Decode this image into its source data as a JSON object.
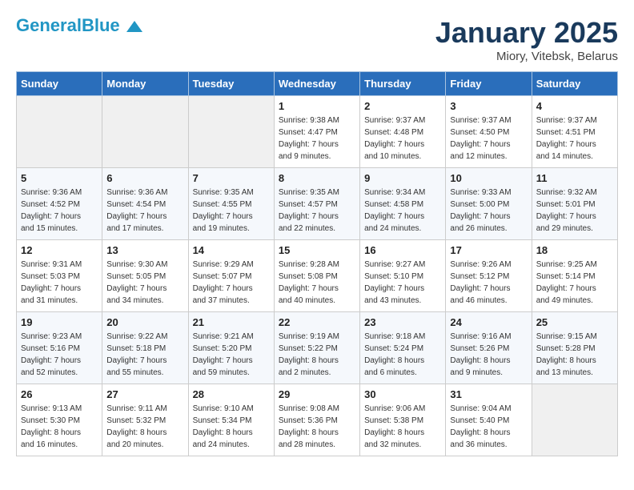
{
  "header": {
    "logo_line1": "General",
    "logo_line2": "Blue",
    "month": "January 2025",
    "location": "Miory, Vitebsk, Belarus"
  },
  "days_of_week": [
    "Sunday",
    "Monday",
    "Tuesday",
    "Wednesday",
    "Thursday",
    "Friday",
    "Saturday"
  ],
  "weeks": [
    [
      {
        "day": "",
        "info": ""
      },
      {
        "day": "",
        "info": ""
      },
      {
        "day": "",
        "info": ""
      },
      {
        "day": "1",
        "info": "Sunrise: 9:38 AM\nSunset: 4:47 PM\nDaylight: 7 hours\nand 9 minutes."
      },
      {
        "day": "2",
        "info": "Sunrise: 9:37 AM\nSunset: 4:48 PM\nDaylight: 7 hours\nand 10 minutes."
      },
      {
        "day": "3",
        "info": "Sunrise: 9:37 AM\nSunset: 4:50 PM\nDaylight: 7 hours\nand 12 minutes."
      },
      {
        "day": "4",
        "info": "Sunrise: 9:37 AM\nSunset: 4:51 PM\nDaylight: 7 hours\nand 14 minutes."
      }
    ],
    [
      {
        "day": "5",
        "info": "Sunrise: 9:36 AM\nSunset: 4:52 PM\nDaylight: 7 hours\nand 15 minutes."
      },
      {
        "day": "6",
        "info": "Sunrise: 9:36 AM\nSunset: 4:54 PM\nDaylight: 7 hours\nand 17 minutes."
      },
      {
        "day": "7",
        "info": "Sunrise: 9:35 AM\nSunset: 4:55 PM\nDaylight: 7 hours\nand 19 minutes."
      },
      {
        "day": "8",
        "info": "Sunrise: 9:35 AM\nSunset: 4:57 PM\nDaylight: 7 hours\nand 22 minutes."
      },
      {
        "day": "9",
        "info": "Sunrise: 9:34 AM\nSunset: 4:58 PM\nDaylight: 7 hours\nand 24 minutes."
      },
      {
        "day": "10",
        "info": "Sunrise: 9:33 AM\nSunset: 5:00 PM\nDaylight: 7 hours\nand 26 minutes."
      },
      {
        "day": "11",
        "info": "Sunrise: 9:32 AM\nSunset: 5:01 PM\nDaylight: 7 hours\nand 29 minutes."
      }
    ],
    [
      {
        "day": "12",
        "info": "Sunrise: 9:31 AM\nSunset: 5:03 PM\nDaylight: 7 hours\nand 31 minutes."
      },
      {
        "day": "13",
        "info": "Sunrise: 9:30 AM\nSunset: 5:05 PM\nDaylight: 7 hours\nand 34 minutes."
      },
      {
        "day": "14",
        "info": "Sunrise: 9:29 AM\nSunset: 5:07 PM\nDaylight: 7 hours\nand 37 minutes."
      },
      {
        "day": "15",
        "info": "Sunrise: 9:28 AM\nSunset: 5:08 PM\nDaylight: 7 hours\nand 40 minutes."
      },
      {
        "day": "16",
        "info": "Sunrise: 9:27 AM\nSunset: 5:10 PM\nDaylight: 7 hours\nand 43 minutes."
      },
      {
        "day": "17",
        "info": "Sunrise: 9:26 AM\nSunset: 5:12 PM\nDaylight: 7 hours\nand 46 minutes."
      },
      {
        "day": "18",
        "info": "Sunrise: 9:25 AM\nSunset: 5:14 PM\nDaylight: 7 hours\nand 49 minutes."
      }
    ],
    [
      {
        "day": "19",
        "info": "Sunrise: 9:23 AM\nSunset: 5:16 PM\nDaylight: 7 hours\nand 52 minutes."
      },
      {
        "day": "20",
        "info": "Sunrise: 9:22 AM\nSunset: 5:18 PM\nDaylight: 7 hours\nand 55 minutes."
      },
      {
        "day": "21",
        "info": "Sunrise: 9:21 AM\nSunset: 5:20 PM\nDaylight: 7 hours\nand 59 minutes."
      },
      {
        "day": "22",
        "info": "Sunrise: 9:19 AM\nSunset: 5:22 PM\nDaylight: 8 hours\nand 2 minutes."
      },
      {
        "day": "23",
        "info": "Sunrise: 9:18 AM\nSunset: 5:24 PM\nDaylight: 8 hours\nand 6 minutes."
      },
      {
        "day": "24",
        "info": "Sunrise: 9:16 AM\nSunset: 5:26 PM\nDaylight: 8 hours\nand 9 minutes."
      },
      {
        "day": "25",
        "info": "Sunrise: 9:15 AM\nSunset: 5:28 PM\nDaylight: 8 hours\nand 13 minutes."
      }
    ],
    [
      {
        "day": "26",
        "info": "Sunrise: 9:13 AM\nSunset: 5:30 PM\nDaylight: 8 hours\nand 16 minutes."
      },
      {
        "day": "27",
        "info": "Sunrise: 9:11 AM\nSunset: 5:32 PM\nDaylight: 8 hours\nand 20 minutes."
      },
      {
        "day": "28",
        "info": "Sunrise: 9:10 AM\nSunset: 5:34 PM\nDaylight: 8 hours\nand 24 minutes."
      },
      {
        "day": "29",
        "info": "Sunrise: 9:08 AM\nSunset: 5:36 PM\nDaylight: 8 hours\nand 28 minutes."
      },
      {
        "day": "30",
        "info": "Sunrise: 9:06 AM\nSunset: 5:38 PM\nDaylight: 8 hours\nand 32 minutes."
      },
      {
        "day": "31",
        "info": "Sunrise: 9:04 AM\nSunset: 5:40 PM\nDaylight: 8 hours\nand 36 minutes."
      },
      {
        "day": "",
        "info": ""
      }
    ]
  ]
}
